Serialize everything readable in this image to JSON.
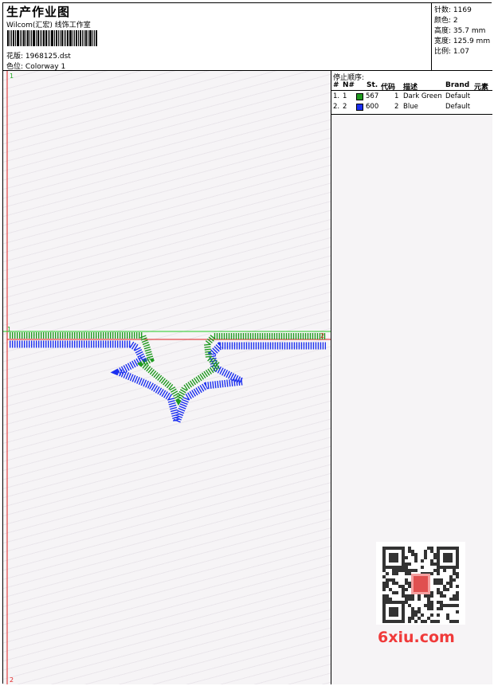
{
  "header": {
    "title": "生产作业图",
    "subtitle": "Wilcom(汇宏) 线饰工作室",
    "design_label": "花版:",
    "design_value": "1968125.dst",
    "color_label": "色位:",
    "color_value": "Colorway 1"
  },
  "stats": [
    {
      "label": "针数:",
      "value": "1169"
    },
    {
      "label": "颜色:",
      "value": "2"
    },
    {
      "label": "高度:",
      "value": "35.7 mm"
    },
    {
      "label": "宽度:",
      "value": "125.9 mm"
    },
    {
      "label": "比例:",
      "value": "1.07"
    }
  ],
  "stop_sequence": {
    "title": "停止顺序:",
    "columns": [
      "#",
      "N#",
      "St.",
      "代码",
      "描述",
      "Brand",
      "元素"
    ],
    "rows": [
      {
        "idx": "1.",
        "n": "1",
        "stitches": "567",
        "code": "1",
        "desc": "Dark Green",
        "brand": "Default",
        "color": "#1f9a1f"
      },
      {
        "idx": "2.",
        "n": "2",
        "stitches": "600",
        "code": "2",
        "desc": "Blue",
        "brand": "Default",
        "color": "#1b2ff0"
      }
    ]
  },
  "canvas_marks": {
    "top_left": "1",
    "bottom_left": "2",
    "mid_left": "1",
    "mid_right": "2"
  },
  "colors": {
    "green": "#1f9a1f",
    "blue": "#1b2ff0",
    "red_guide": "#e02020",
    "green_guide": "#22cc22"
  },
  "watermark": {
    "site": "6xiu.com"
  }
}
